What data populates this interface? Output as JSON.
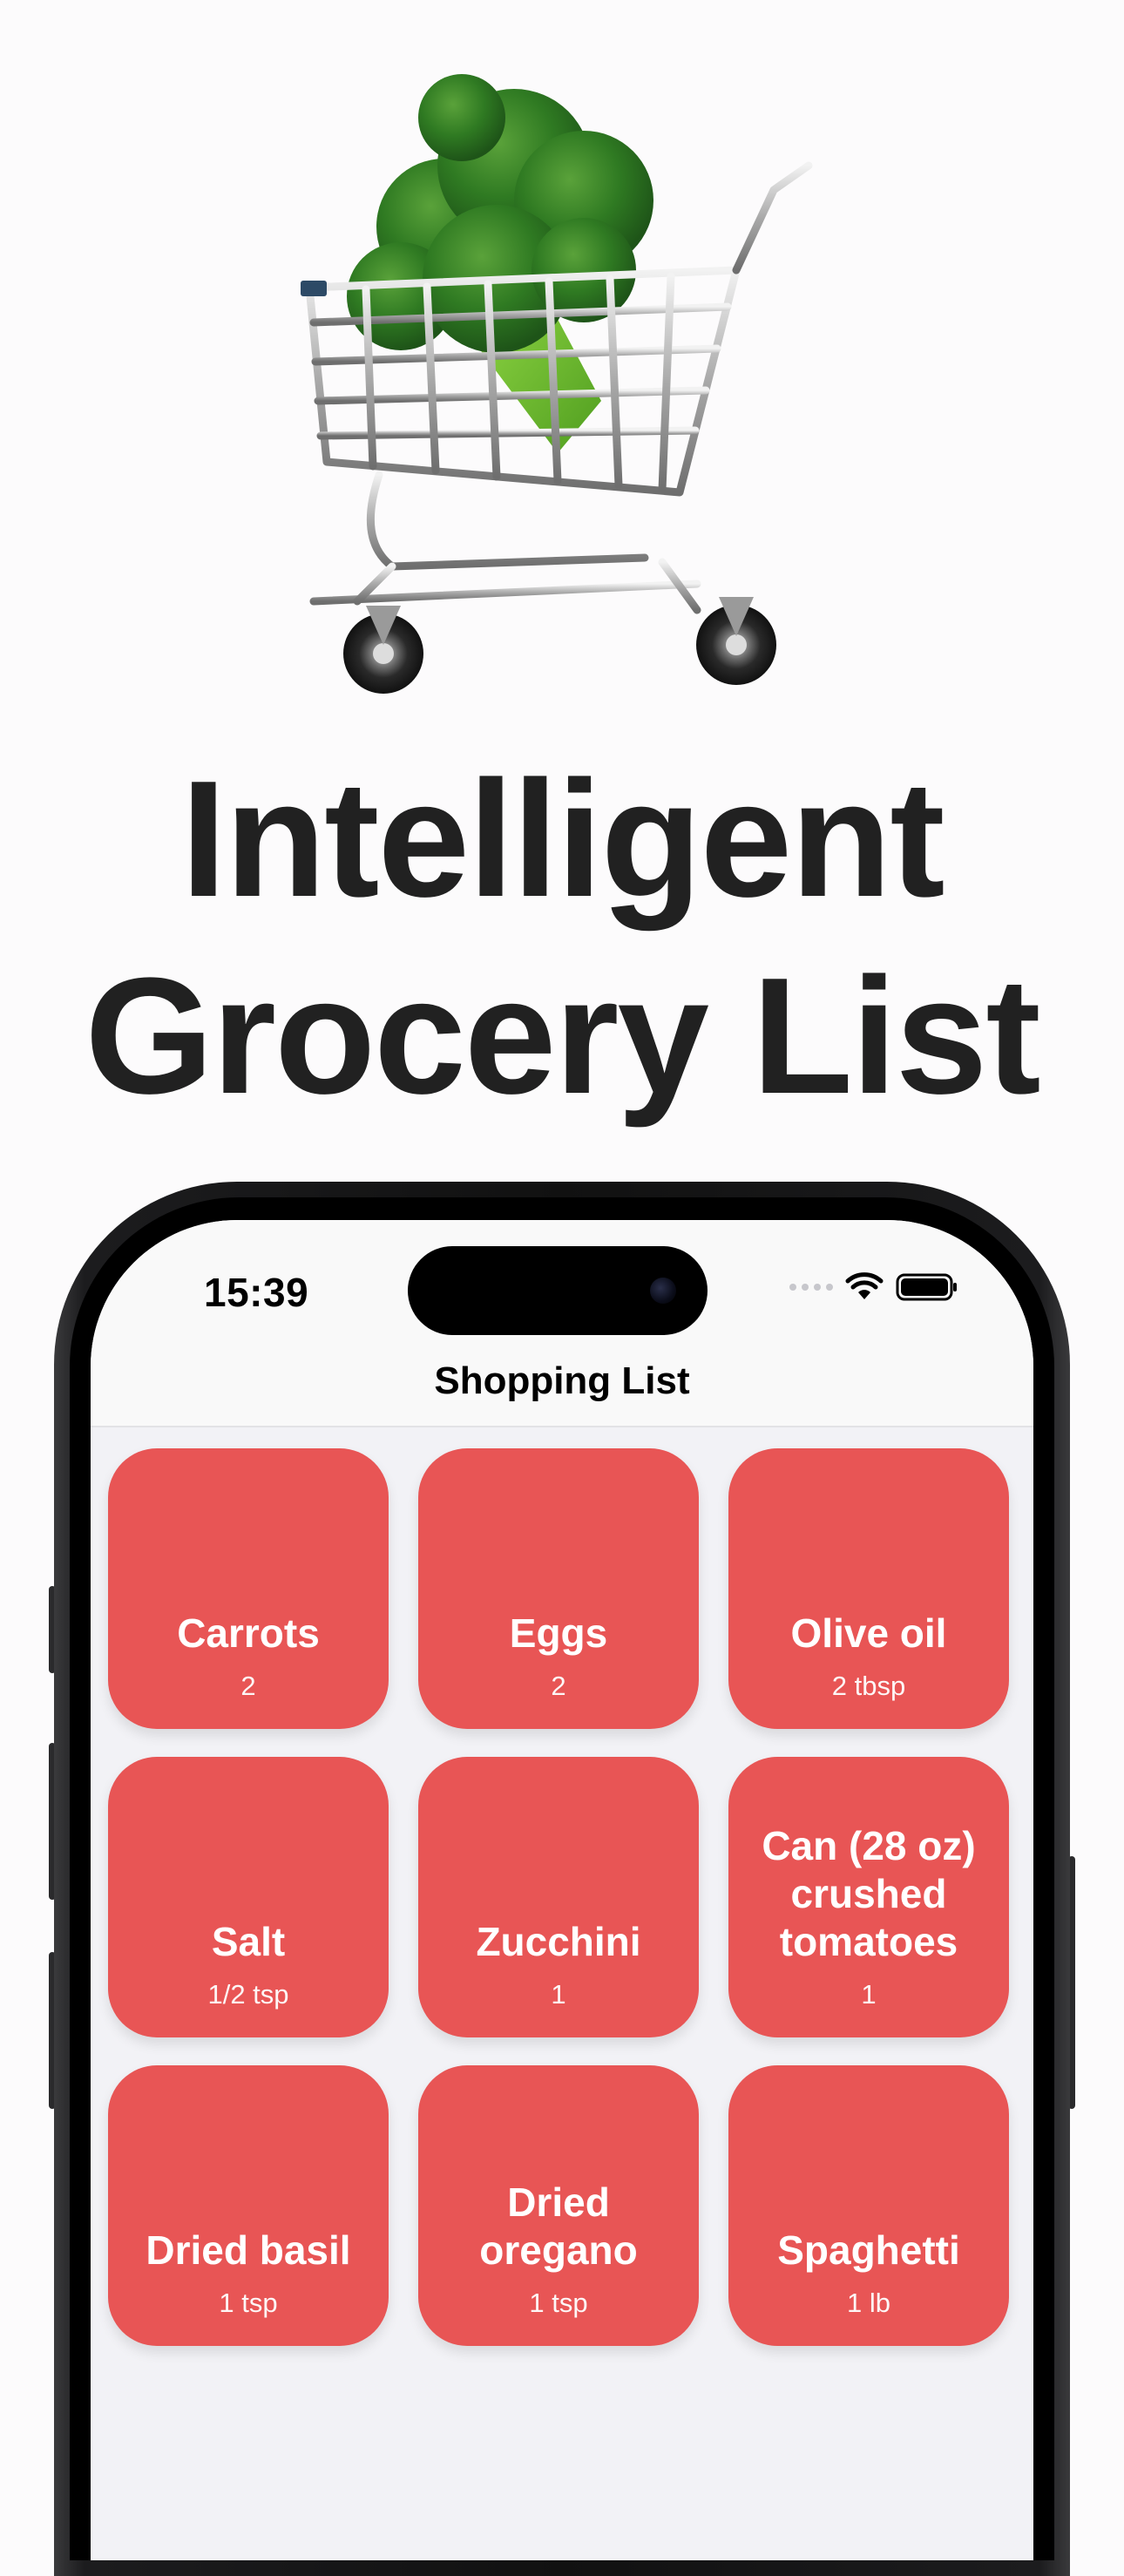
{
  "headline": {
    "line1": "Intelligent",
    "line2": "Grocery List"
  },
  "status_bar": {
    "time": "15:39",
    "icons": [
      "cellular-icon",
      "wifi-icon",
      "battery-icon"
    ]
  },
  "nav": {
    "title": "Shopping List"
  },
  "items": [
    {
      "name": "Carrots",
      "quantity": "2"
    },
    {
      "name": "Eggs",
      "quantity": "2"
    },
    {
      "name": "Olive oil",
      "quantity": "2 tbsp"
    },
    {
      "name": "Salt",
      "quantity": "1/2 tsp"
    },
    {
      "name": "Zucchini",
      "quantity": "1"
    },
    {
      "name": "Can (28 oz) crushed tomatoes",
      "quantity": "1"
    },
    {
      "name": "Dried basil",
      "quantity": "1 tsp"
    },
    {
      "name": "Dried oregano",
      "quantity": "1 tsp"
    },
    {
      "name": "Spaghetti",
      "quantity": "1 lb"
    }
  ],
  "colors": {
    "tile": "#e85555",
    "headline": "#212121",
    "background": "#fcfbfc"
  }
}
